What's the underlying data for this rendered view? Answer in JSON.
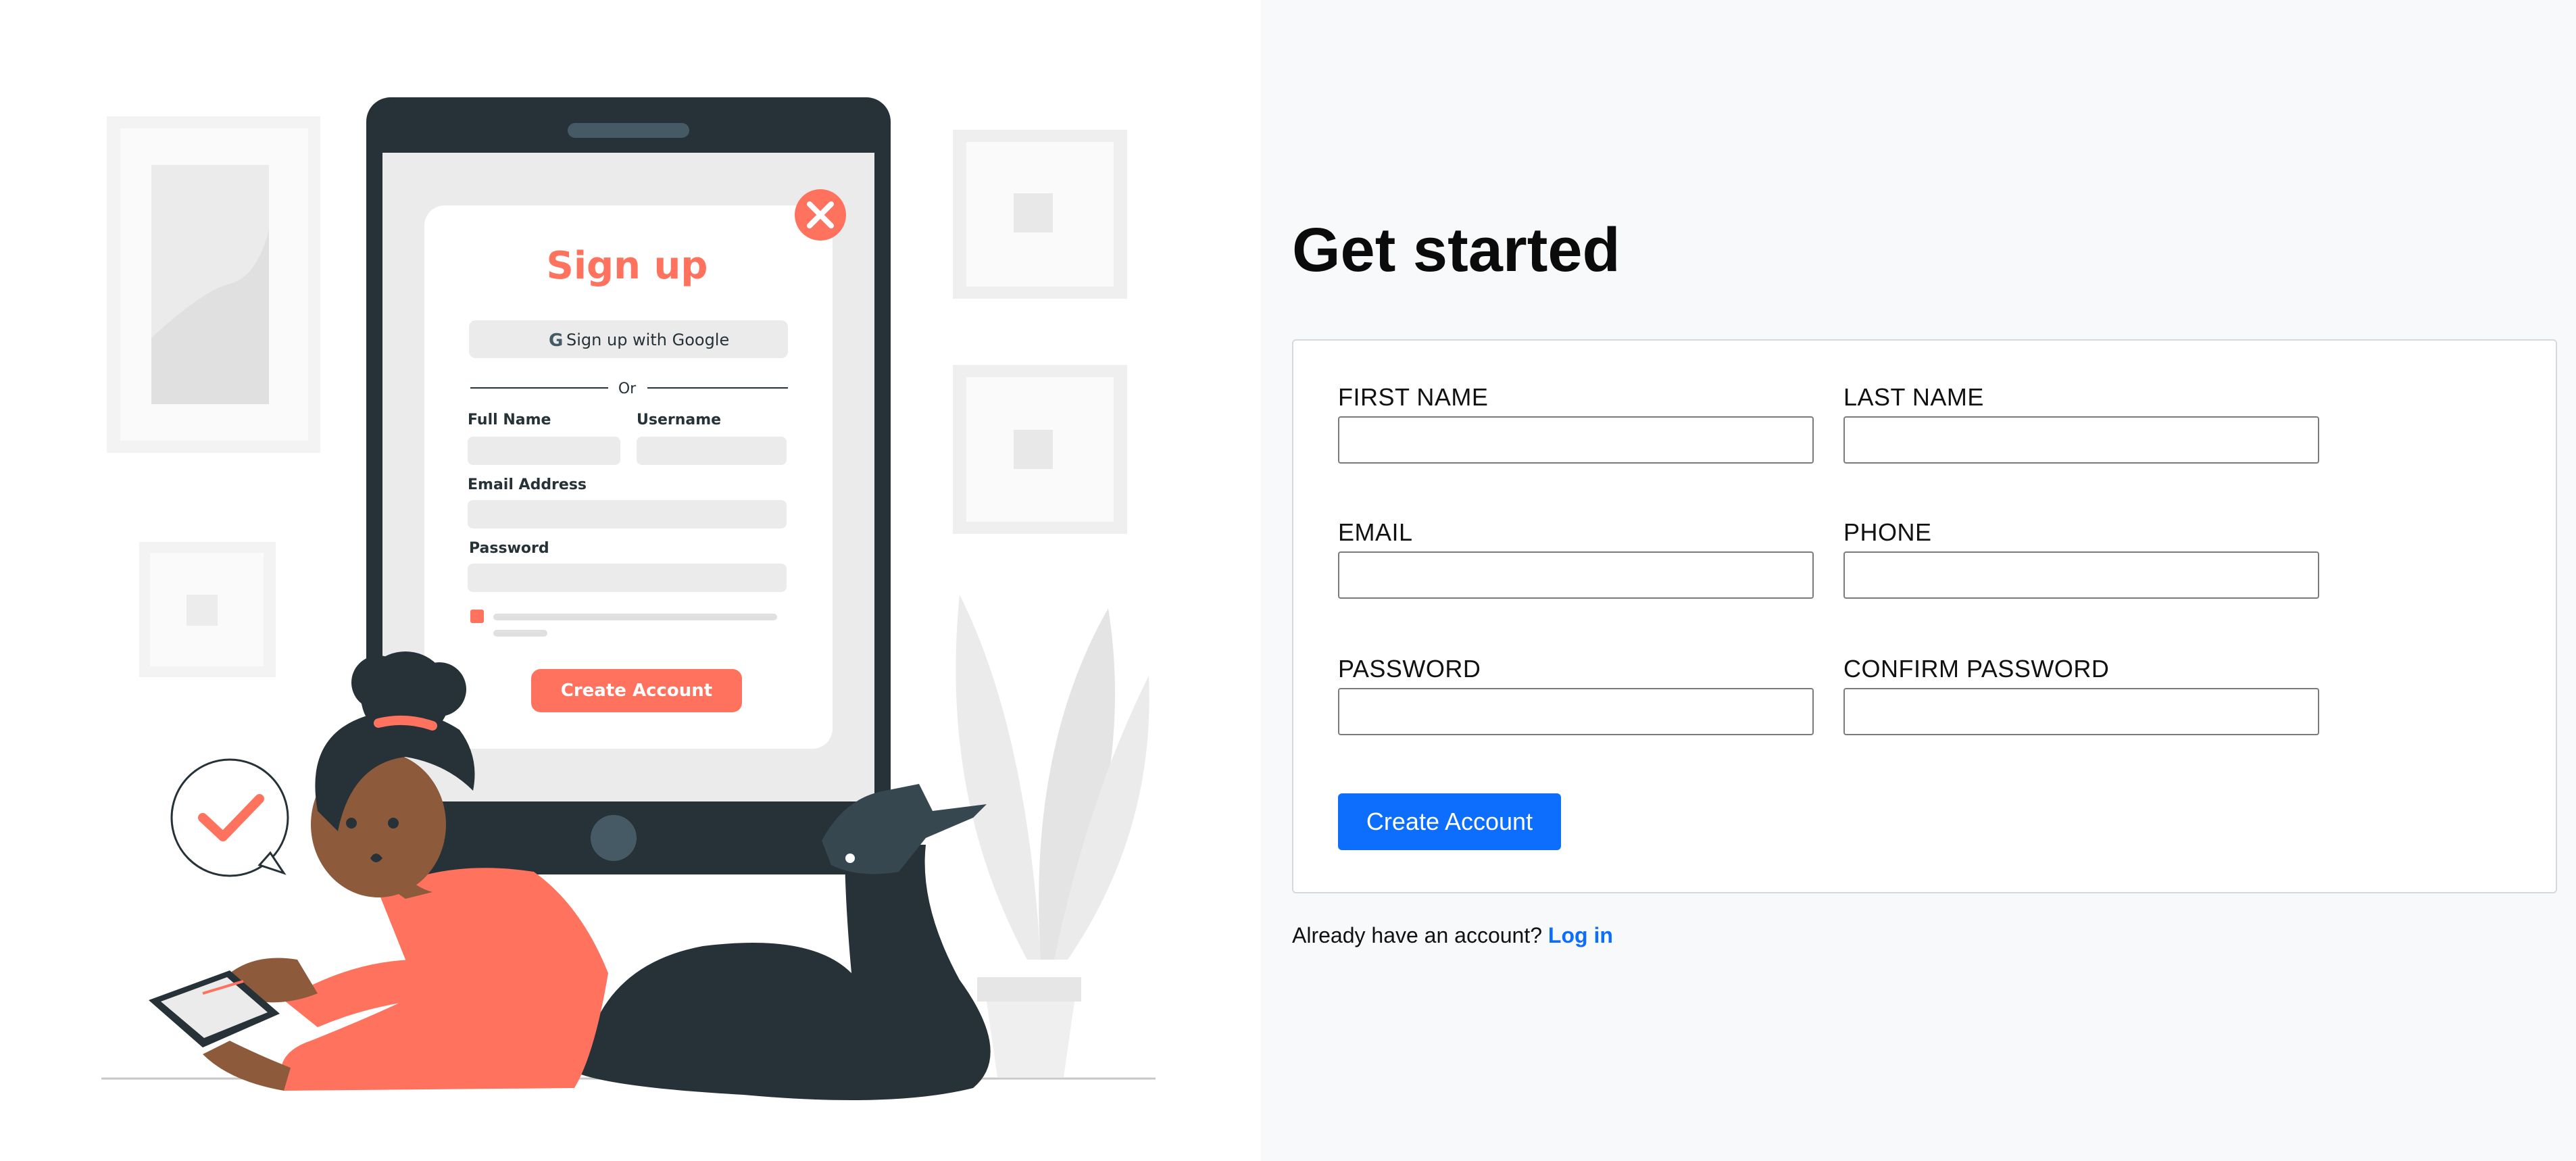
{
  "illustration": {
    "tablet_heading": "Sign up",
    "google_button": "Sign up with Google",
    "divider": "Or",
    "label_full_name": "Full Name",
    "label_username": "Username",
    "label_email": "Email Address",
    "label_password": "Password",
    "create_button": "Create Account"
  },
  "form": {
    "title": "Get started",
    "fields": {
      "first_name": {
        "label": "FIRST NAME",
        "value": ""
      },
      "last_name": {
        "label": "LAST NAME",
        "value": ""
      },
      "email": {
        "label": "EMAIL",
        "value": ""
      },
      "phone": {
        "label": "PHONE",
        "value": ""
      },
      "password": {
        "label": "PASSWORD",
        "value": ""
      },
      "confirm_password": {
        "label": "CONFIRM PASSWORD",
        "value": ""
      }
    },
    "submit_label": "Create Account"
  },
  "footer": {
    "prompt": "Already have an account?",
    "login_label": "Log in"
  },
  "colors": {
    "accent": "#0d6efd",
    "illustration_coral": "#ff725e",
    "illustration_dark": "#263238"
  }
}
